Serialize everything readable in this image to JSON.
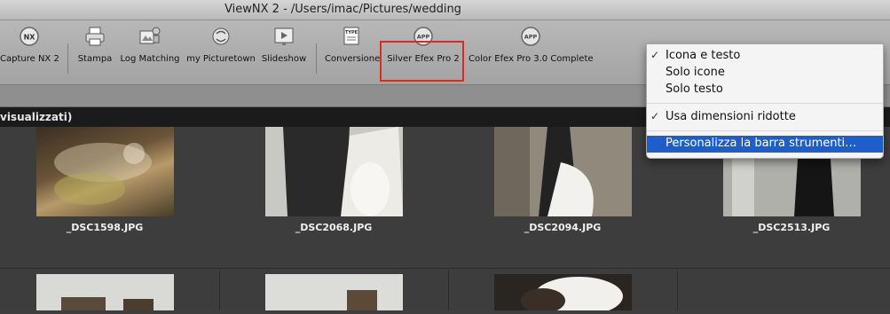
{
  "window": {
    "title": "ViewNX 2 - /Users/imac/Pictures/wedding"
  },
  "toolbar": {
    "items": [
      {
        "label": "Capture NX 2",
        "icon": "nx-badge-icon"
      },
      {
        "label": "Stampa",
        "icon": "printer-icon"
      },
      {
        "label": "Log Matching",
        "icon": "log-matching-icon"
      },
      {
        "label": "my Picturetown",
        "icon": "picturetown-icon"
      },
      {
        "label": "Slideshow",
        "icon": "slideshow-icon"
      },
      {
        "label": "Conversione",
        "icon": "conversion-icon"
      },
      {
        "label": "Silver Efex Pro 2",
        "icon": "app-badge-icon"
      },
      {
        "label": "Color Efex Pro 3.0 Complete",
        "icon": "app-badge-icon"
      }
    ],
    "highlight_color": "#e02a1a"
  },
  "path_bar": {
    "text": "visualizzati)"
  },
  "context_menu": {
    "items": [
      {
        "label": "Icona e testo",
        "check": "✓"
      },
      {
        "label": "Solo icone",
        "check": ""
      },
      {
        "label": "Solo testo",
        "check": ""
      },
      {
        "label": "Usa dimensioni ridotte",
        "check": "✓"
      },
      {
        "label": "Personalizza la barra strumenti…",
        "check": ""
      }
    ],
    "highlight_color": "#1f5ec9"
  },
  "thumbnails": [
    {
      "filename": "_DSC1598.JPG"
    },
    {
      "filename": "_DSC2068.JPG"
    },
    {
      "filename": "_DSC2094.JPG"
    },
    {
      "filename": "_DSC2513.JPG"
    }
  ]
}
